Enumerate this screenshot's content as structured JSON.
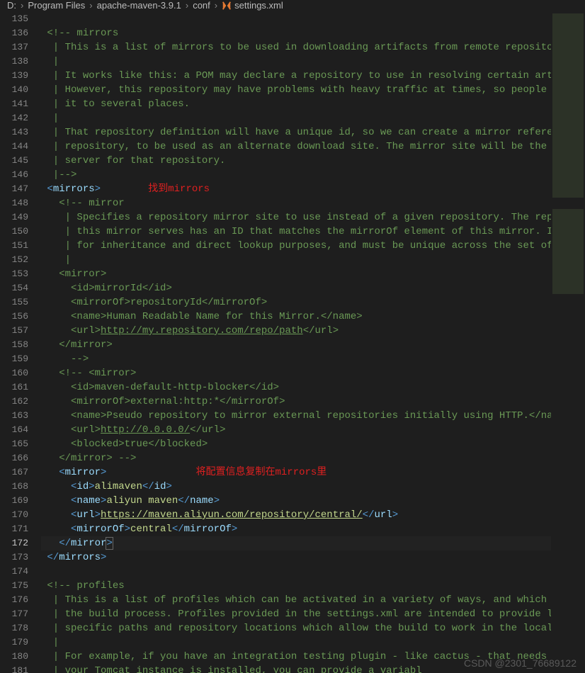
{
  "breadcrumb": [
    "D:",
    "Program Files",
    "apache-maven-3.9.1",
    "conf",
    "settings.xml"
  ],
  "watermark": "CSDN @2301_76689122",
  "annotations": {
    "findMirrors": "找到mirrors",
    "copyConfig": "将配置信息复制在mirrors里"
  },
  "lines": [
    {
      "n": 135,
      "i": 0,
      "t": [
        [
          " ",
          ""
        ]
      ]
    },
    {
      "n": 136,
      "i": 0,
      "t": [
        [
          "<!-- mirrors",
          "cmt"
        ]
      ]
    },
    {
      "n": 137,
      "i": 0,
      "t": [
        [
          " | This is a list of mirrors to be used in downloading artifacts from remote repositor",
          "cmt"
        ]
      ]
    },
    {
      "n": 138,
      "i": 0,
      "t": [
        [
          " |",
          "cmt"
        ]
      ]
    },
    {
      "n": 139,
      "i": 0,
      "t": [
        [
          " | It works like this: a POM may declare a repository to use in resolving certain arti",
          "cmt"
        ]
      ]
    },
    {
      "n": 140,
      "i": 0,
      "t": [
        [
          " | However, this repository may have problems with heavy traffic at times, so people h",
          "cmt"
        ]
      ]
    },
    {
      "n": 141,
      "i": 0,
      "t": [
        [
          " | it to several places.",
          "cmt"
        ]
      ]
    },
    {
      "n": 142,
      "i": 0,
      "t": [
        [
          " |",
          "cmt"
        ]
      ]
    },
    {
      "n": 143,
      "i": 0,
      "t": [
        [
          " | That repository definition will have a unique id, so we can create a mirror referen",
          "cmt"
        ]
      ]
    },
    {
      "n": 144,
      "i": 0,
      "t": [
        [
          " | repository, to be used as an alternate download site. The mirror site will be the p",
          "cmt"
        ]
      ]
    },
    {
      "n": 145,
      "i": 0,
      "t": [
        [
          " | server for that repository.",
          "cmt"
        ]
      ]
    },
    {
      "n": 146,
      "i": 0,
      "t": [
        [
          " |-->",
          "cmt"
        ]
      ]
    },
    {
      "n": 147,
      "i": 0,
      "t": [
        [
          "<",
          "tag"
        ],
        [
          "mirrors",
          "name"
        ],
        [
          ">",
          "tag"
        ],
        [
          "        ",
          ""
        ],
        [
          "找到mirrors",
          "annot"
        ]
      ]
    },
    {
      "n": 148,
      "i": 1,
      "t": [
        [
          "<!-- mirror",
          "cmt"
        ]
      ]
    },
    {
      "n": 149,
      "i": 1,
      "t": [
        [
          " | Specifies a repository mirror site to use instead of a given repository. The repo",
          "cmt"
        ]
      ]
    },
    {
      "n": 150,
      "i": 1,
      "t": [
        [
          " | this mirror serves has an ID that matches the mirrorOf element of this mirror. ID",
          "cmt"
        ]
      ]
    },
    {
      "n": 151,
      "i": 1,
      "t": [
        [
          " | for inheritance and direct lookup purposes, and must be unique across the set of ",
          "cmt"
        ]
      ]
    },
    {
      "n": 152,
      "i": 1,
      "t": [
        [
          " |",
          "cmt"
        ]
      ]
    },
    {
      "n": 153,
      "i": 1,
      "t": [
        [
          "<mirror>",
          "cmt"
        ]
      ]
    },
    {
      "n": 154,
      "i": 2,
      "t": [
        [
          "<id>mirrorId</id>",
          "cmt"
        ]
      ]
    },
    {
      "n": 155,
      "i": 2,
      "t": [
        [
          "<mirrorOf>repositoryId</mirrorOf>",
          "cmt"
        ]
      ]
    },
    {
      "n": 156,
      "i": 2,
      "t": [
        [
          "<name>Human Readable Name for this Mirror.</name>",
          "cmt"
        ]
      ]
    },
    {
      "n": 157,
      "i": 2,
      "t": [
        [
          "<url>",
          "cmt"
        ],
        [
          "http://my.repository.com/repo/path",
          "url-cmt"
        ],
        [
          "</url>",
          "cmt"
        ]
      ]
    },
    {
      "n": 158,
      "i": 1,
      "t": [
        [
          "</mirror>",
          "cmt"
        ]
      ]
    },
    {
      "n": 159,
      "i": 2,
      "t": [
        [
          "-->",
          "cmt"
        ]
      ]
    },
    {
      "n": 160,
      "i": 1,
      "t": [
        [
          "<!-- <mirror>",
          "cmt"
        ]
      ]
    },
    {
      "n": 161,
      "i": 2,
      "t": [
        [
          "<id>maven-default-http-blocker</id>",
          "cmt"
        ]
      ]
    },
    {
      "n": 162,
      "i": 2,
      "t": [
        [
          "<mirrorOf>external:http:*</mirrorOf>",
          "cmt"
        ]
      ]
    },
    {
      "n": 163,
      "i": 2,
      "t": [
        [
          "<name>Pseudo repository to mirror external repositories initially using HTTP.</nam",
          "cmt"
        ]
      ]
    },
    {
      "n": 164,
      "i": 2,
      "t": [
        [
          "<url>",
          "cmt"
        ],
        [
          "http://0.0.0.0/",
          "url-cmt"
        ],
        [
          "</url>",
          "cmt"
        ]
      ]
    },
    {
      "n": 165,
      "i": 2,
      "t": [
        [
          "<blocked>true</blocked>",
          "cmt"
        ]
      ]
    },
    {
      "n": 166,
      "i": 1,
      "t": [
        [
          "</mirror> -->",
          "cmt"
        ]
      ]
    },
    {
      "n": 167,
      "i": 1,
      "t": [
        [
          "<",
          "tag"
        ],
        [
          "mirror",
          "name"
        ],
        [
          ">",
          "tag"
        ],
        [
          "               ",
          ""
        ],
        [
          "将配置信息复制在mirrors里",
          "annot"
        ]
      ]
    },
    {
      "n": 168,
      "i": 2,
      "t": [
        [
          "<",
          "tag"
        ],
        [
          "id",
          "name"
        ],
        [
          ">",
          "tag"
        ],
        [
          "alimaven",
          "str"
        ],
        [
          "</",
          "tag"
        ],
        [
          "id",
          "name"
        ],
        [
          ">",
          "tag"
        ]
      ]
    },
    {
      "n": 169,
      "i": 2,
      "t": [
        [
          "<",
          "tag"
        ],
        [
          "name",
          "name"
        ],
        [
          ">",
          "tag"
        ],
        [
          "aliyun maven",
          "str"
        ],
        [
          "</",
          "tag"
        ],
        [
          "name",
          "name"
        ],
        [
          ">",
          "tag"
        ]
      ]
    },
    {
      "n": 170,
      "i": 2,
      "t": [
        [
          "<",
          "tag"
        ],
        [
          "url",
          "name"
        ],
        [
          ">",
          "tag"
        ],
        [
          "https://maven.aliyun.com/repository/central/",
          "url"
        ],
        [
          "</",
          "tag"
        ],
        [
          "url",
          "name"
        ],
        [
          ">",
          "tag"
        ]
      ]
    },
    {
      "n": 171,
      "i": 2,
      "t": [
        [
          "<",
          "tag"
        ],
        [
          "mirrorOf",
          "name"
        ],
        [
          ">",
          "tag"
        ],
        [
          "central",
          "str"
        ],
        [
          "</",
          "tag"
        ],
        [
          "mirrorOf",
          "name"
        ],
        [
          ">",
          "tag"
        ]
      ]
    },
    {
      "n": 172,
      "i": 1,
      "t": [
        [
          "</",
          "tag"
        ],
        [
          "mirror",
          "name"
        ],
        [
          ">",
          "tag",
          "boxed"
        ]
      ],
      "current": true
    },
    {
      "n": 173,
      "i": 0,
      "t": [
        [
          "</",
          "tag"
        ],
        [
          "mirrors",
          "name"
        ],
        [
          ">",
          "tag"
        ]
      ]
    },
    {
      "n": 174,
      "i": 0,
      "t": [
        [
          " ",
          ""
        ]
      ]
    },
    {
      "n": 175,
      "i": 0,
      "t": [
        [
          "<!-- profiles",
          "cmt"
        ]
      ]
    },
    {
      "n": 176,
      "i": 0,
      "t": [
        [
          " | This is a list of profiles which can be activated in a variety of ways, and which c",
          "cmt"
        ]
      ]
    },
    {
      "n": 177,
      "i": 0,
      "t": [
        [
          " | the build process. Profiles provided in the settings.xml are intended to provide lo",
          "cmt"
        ]
      ]
    },
    {
      "n": 178,
      "i": 0,
      "t": [
        [
          " | specific paths and repository locations which allow the build to work in the local ",
          "cmt"
        ]
      ]
    },
    {
      "n": 179,
      "i": 0,
      "t": [
        [
          " |",
          "cmt"
        ]
      ]
    },
    {
      "n": 180,
      "i": 0,
      "t": [
        [
          " | For example, if you have an integration testing plugin - like cactus - that needs t",
          "cmt"
        ]
      ]
    },
    {
      "n": 181,
      "i": 0,
      "t": [
        [
          " | your Tomcat instance is installed, you can provide a variabl",
          "cmt"
        ]
      ]
    }
  ]
}
